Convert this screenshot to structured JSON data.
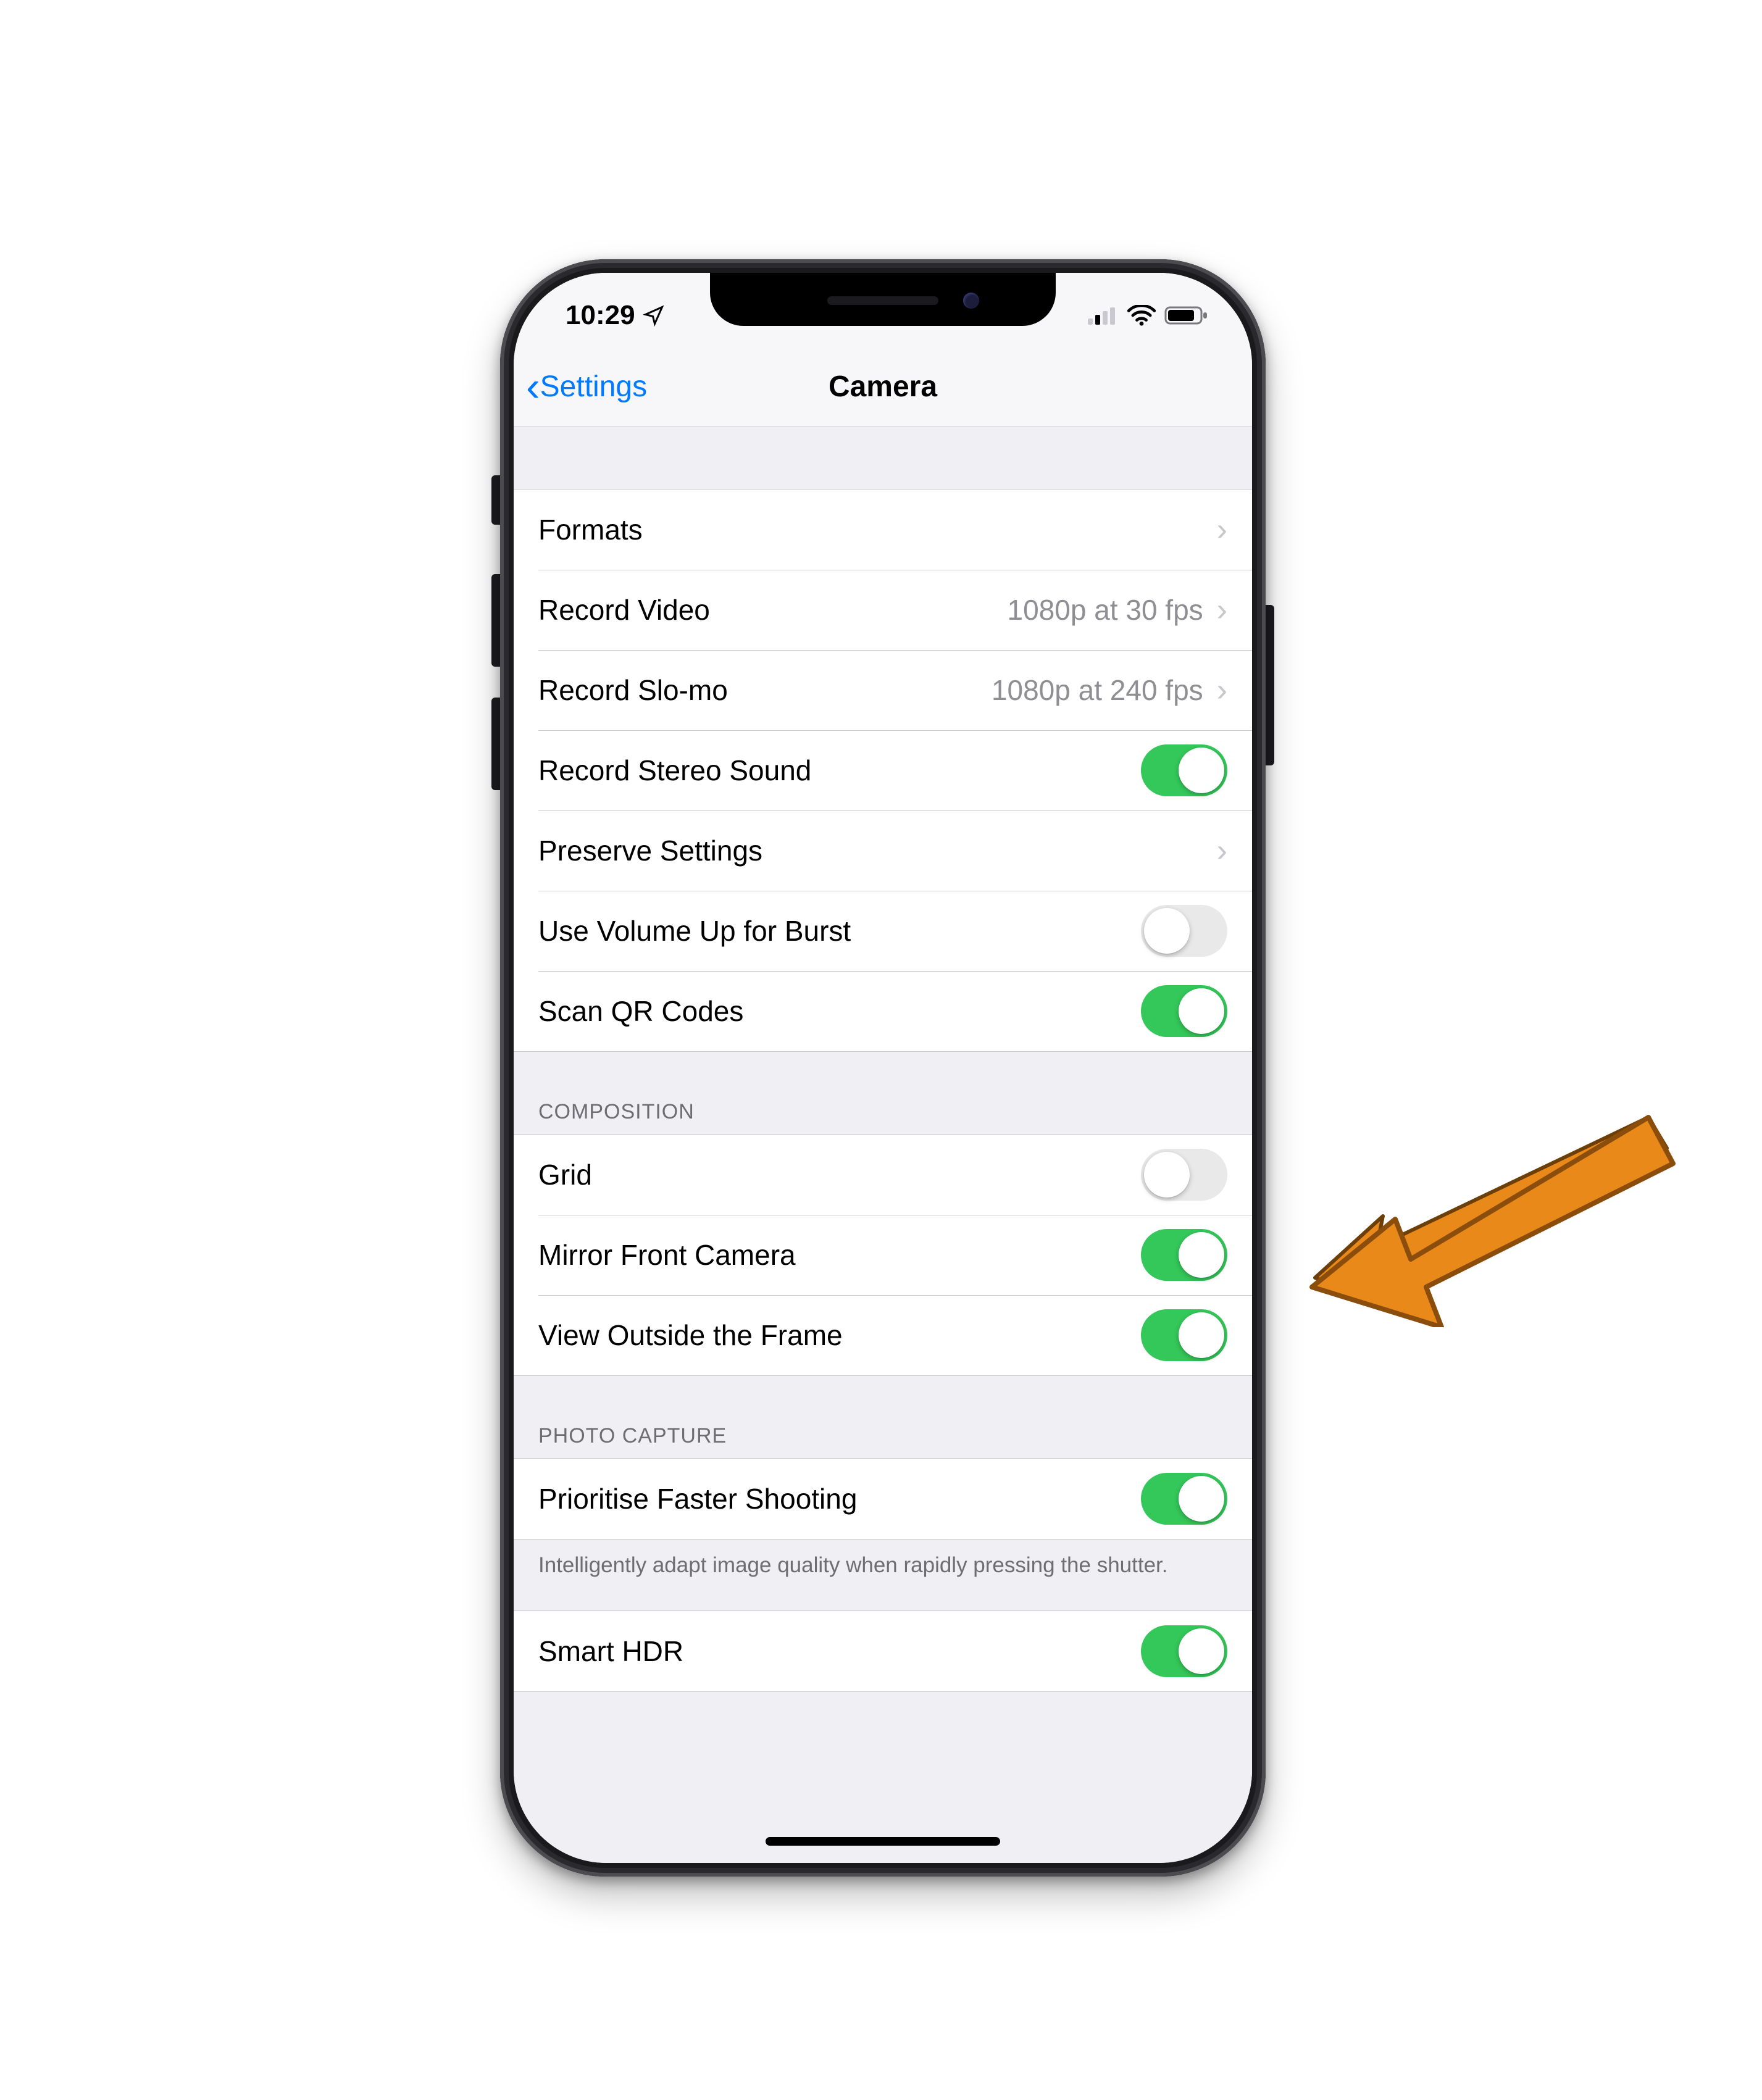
{
  "status": {
    "time": "10:29",
    "location_icon": "location-arrow"
  },
  "nav": {
    "back_label": "Settings",
    "title": "Camera"
  },
  "groups": {
    "general": {
      "formats": {
        "label": "Formats",
        "type": "nav"
      },
      "record_video": {
        "label": "Record Video",
        "value": "1080p at 30 fps",
        "type": "nav"
      },
      "record_slomo": {
        "label": "Record Slo-mo",
        "value": "1080p at 240 fps",
        "type": "nav"
      },
      "record_stereo": {
        "label": "Record Stereo Sound",
        "type": "toggle",
        "on": true
      },
      "preserve": {
        "label": "Preserve Settings",
        "type": "nav"
      },
      "volume_burst": {
        "label": "Use Volume Up for Burst",
        "type": "toggle",
        "on": false
      },
      "scan_qr": {
        "label": "Scan QR Codes",
        "type": "toggle",
        "on": true
      }
    },
    "composition": {
      "header": "COMPOSITION",
      "grid": {
        "label": "Grid",
        "type": "toggle",
        "on": false
      },
      "mirror": {
        "label": "Mirror Front Camera",
        "type": "toggle",
        "on": true
      },
      "view_outside": {
        "label": "View Outside the Frame",
        "type": "toggle",
        "on": true
      }
    },
    "capture": {
      "header": "PHOTO CAPTURE",
      "prioritise": {
        "label": "Prioritise Faster Shooting",
        "type": "toggle",
        "on": true
      },
      "footer": "Intelligently adapt image quality when rapidly pressing the shutter.",
      "smart_hdr": {
        "label": "Smart HDR",
        "type": "toggle",
        "on": true
      }
    }
  },
  "annotation": {
    "arrow_color": "#e8891a"
  }
}
